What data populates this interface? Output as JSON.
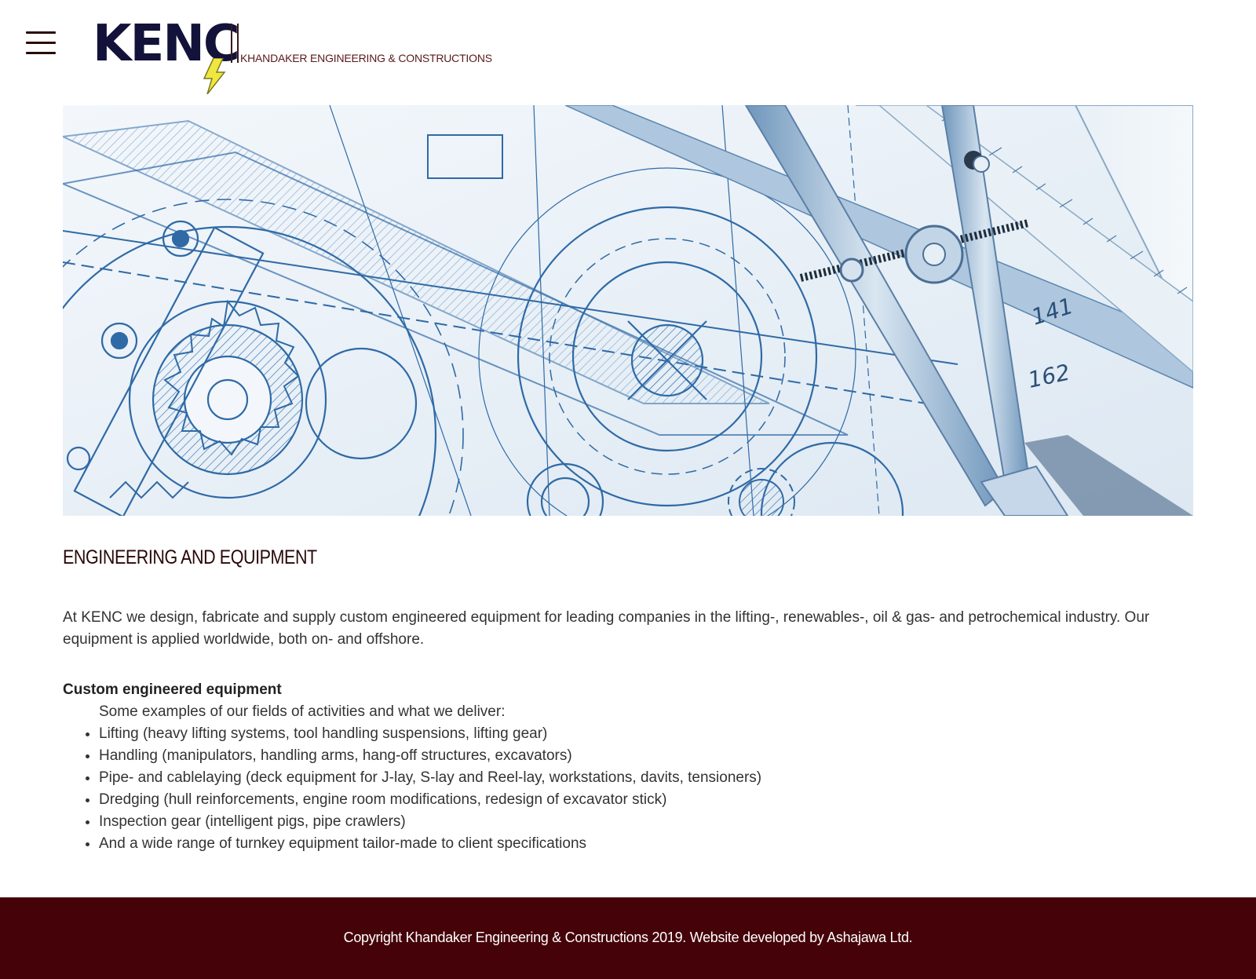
{
  "header": {
    "menu_icon": "hamburger-menu-icon",
    "logo": {
      "mark": "KENC",
      "company_name": "KHANDAKER ENGINEERING & CONSTRUCTIONS",
      "accent_color": "#f0e640",
      "bolt_icon": "lightning-bolt-icon"
    }
  },
  "hero": {
    "description": "engineering blueprint banner with drafting compass and ruler"
  },
  "main": {
    "title": "ENGINEERING AND EQUIPMENT",
    "intro": "At KENC we design, fabricate and supply custom engineered equipment for leading companies in the lifting-, renewables-, oil & gas- and petrochemical industry. Our equipment is applied worldwide, both on- and offshore.",
    "subheading": "Custom engineered equipment",
    "lead": "Some examples of our fields of activities and what we deliver:",
    "items": [
      "Lifting (heavy lifting systems, tool handling suspensions, lifting gear)",
      "Handling (manipulators, handling arms, hang-off structures, excavators)",
      "Pipe- and cablelaying (deck equipment for J-lay, S-lay and Reel-lay, workstations, davits, tensioners)",
      "Dredging (hull reinforcements, engine room modifications, redesign of excavator stick)",
      "Inspection gear (intelligent pigs, pipe crawlers)",
      "And a wide range of turnkey equipment tailor-made to client specifications"
    ]
  },
  "footer": {
    "text": "Copyright Khandaker Engineering & Constructions 2019. Website developed by Ashajawa Ltd.",
    "background": "#450309"
  }
}
